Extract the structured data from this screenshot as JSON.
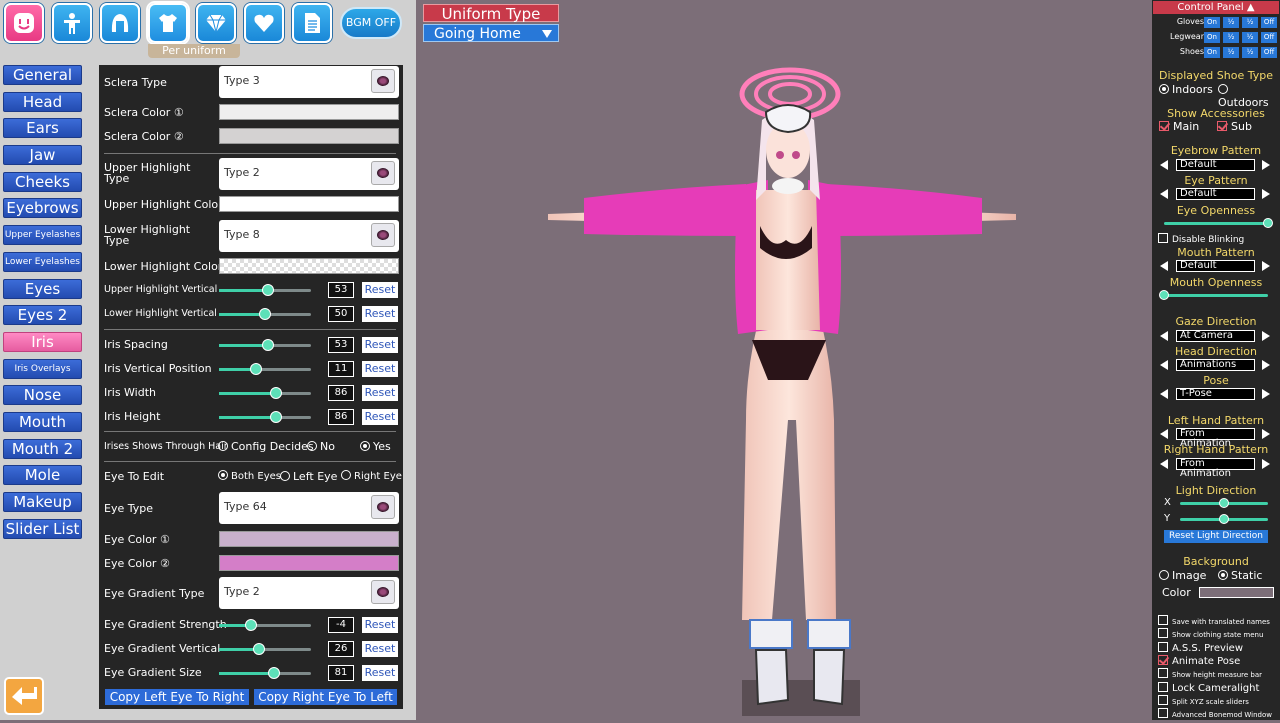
{
  "topbar": {
    "per_uniform": "Per uniform",
    "bgm": "BGM OFF",
    "icons": [
      "face-icon",
      "body-icon",
      "hair-icon",
      "shirt-icon",
      "diamond-icon",
      "heart-icon",
      "document-icon"
    ]
  },
  "categories": [
    "General",
    "Head",
    "Ears",
    "Jaw",
    "Cheeks",
    "Eyebrows",
    "Upper Eyelashes",
    "Lower Eyelashes",
    "Eyes",
    "Eyes 2",
    "Iris",
    "Iris Overlays",
    "Nose",
    "Mouth",
    "Mouth 2",
    "Mole",
    "Makeup",
    "Slider List"
  ],
  "selected_category": "Iris",
  "panel": {
    "sclera_type_label": "Sclera Type",
    "sclera_type_value": "Type 3",
    "sclera_color1_label": "Sclera Color ①",
    "sclera_color2_label": "Sclera Color ②",
    "upper_highlight_type_label": "Upper Highlight Type",
    "upper_highlight_type_value": "Type 2",
    "upper_highlight_color_label": "Upper Highlight Color",
    "lower_highlight_type_label": "Lower Highlight Type",
    "lower_highlight_type_value": "Type 8",
    "lower_highlight_color_label": "Lower Highlight Color",
    "sliders1": [
      {
        "label": "Upper Highlight Vertical",
        "value": "53",
        "pct": 0.53
      },
      {
        "label": "Lower Highlight Vertical",
        "value": "50",
        "pct": 0.5
      }
    ],
    "sliders2": [
      {
        "label": "Iris Spacing",
        "value": "53",
        "pct": 0.53
      },
      {
        "label": "Iris Vertical Position",
        "value": "11",
        "pct": 0.4
      },
      {
        "label": "Iris Width",
        "value": "86",
        "pct": 0.62
      },
      {
        "label": "Iris Height",
        "value": "86",
        "pct": 0.62
      }
    ],
    "reset_label": "Reset",
    "iris_hair_label": "Irises Shows Through Hair",
    "iris_hair_opt1": "Config Decides",
    "iris_hair_opt2": "No",
    "iris_hair_opt3": "Yes",
    "eye_to_edit_label": "Eye To Edit",
    "eye_opt1": "Both Eyes",
    "eye_opt2": "Left Eye",
    "eye_opt3": "Right Eye",
    "eye_type_label": "Eye Type",
    "eye_type_value": "Type 64",
    "eye_color1_label": "Eye Color ①",
    "eye_color2_label": "Eye Color ②",
    "eye_gradient_type_label": "Eye Gradient Type",
    "eye_gradient_type_value": "Type 2",
    "sliders3": [
      {
        "label": "Eye Gradient Strength",
        "value": "-4",
        "pct": 0.35
      },
      {
        "label": "Eye Gradient Vertical",
        "value": "26",
        "pct": 0.43
      },
      {
        "label": "Eye Gradient Size",
        "value": "81",
        "pct": 0.6
      }
    ],
    "copy_left": "Copy Left Eye To Right",
    "copy_right": "Copy Right Eye To Left",
    "colors": {
      "sclera1": "#efeeee",
      "sclera2": "#d4d2d2",
      "upper_hl": "#ffffff",
      "eye1": "#c9b0cc",
      "eye2": "#d47ec8"
    }
  },
  "uniform": {
    "title": "Uniform Type",
    "value": "Going Home"
  },
  "control_panel": {
    "title": "Control Panel",
    "toggle_rows": [
      {
        "label": "Gloves"
      },
      {
        "label": "Legwear"
      },
      {
        "label": "Shoes"
      }
    ],
    "toggle_opts": [
      "On",
      "½",
      "½",
      "Off"
    ],
    "shoe_type_title": "Displayed Shoe Type",
    "shoe_opt1": "Indoors",
    "shoe_opt2": "Outdoors",
    "accessories_title": "Show Accessories",
    "acc_main": "Main",
    "acc_sub": "Sub",
    "eyebrow_pattern_title": "Eyebrow Pattern",
    "eyebrow_pattern": "Default",
    "eye_pattern_title": "Eye Pattern",
    "eye_pattern": "Default",
    "eye_openness_title": "Eye Openness",
    "disable_blinking": "Disable Blinking",
    "mouth_pattern_title": "Mouth Pattern",
    "mouth_pattern": "Default",
    "mouth_openness_title": "Mouth Openness",
    "gaze_title": "Gaze Direction",
    "gaze": "At Camera",
    "head_dir_title": "Head Direction",
    "head_dir": "Animations",
    "pose_title": "Pose",
    "pose": "T-Pose",
    "left_hand_title": "Left Hand Pattern",
    "left_hand": "From Animation",
    "right_hand_title": "Right Hand Pattern",
    "right_hand": "From Animation",
    "light_title": "Light Direction",
    "light_x": "X",
    "light_y": "Y",
    "reset_light": "Reset Light Direction",
    "background_title": "Background",
    "bg_opt1": "Image",
    "bg_opt2": "Static",
    "bg_color": "Color",
    "opts": [
      {
        "label": "Save with translated names",
        "small": true,
        "on": false
      },
      {
        "label": "Show clothing state menu",
        "small": true,
        "on": false
      },
      {
        "label": "A.S.S. Preview",
        "small": false,
        "on": false
      },
      {
        "label": "Animate Pose",
        "small": false,
        "on": true
      },
      {
        "label": "Show height measure bar",
        "small": true,
        "on": false
      },
      {
        "label": "Lock Cameralight",
        "small": false,
        "on": false
      },
      {
        "label": "Split XYZ scale sliders",
        "small": true,
        "on": false
      },
      {
        "label": "Advanced Bonemod Window",
        "small": true,
        "on": false
      }
    ]
  }
}
